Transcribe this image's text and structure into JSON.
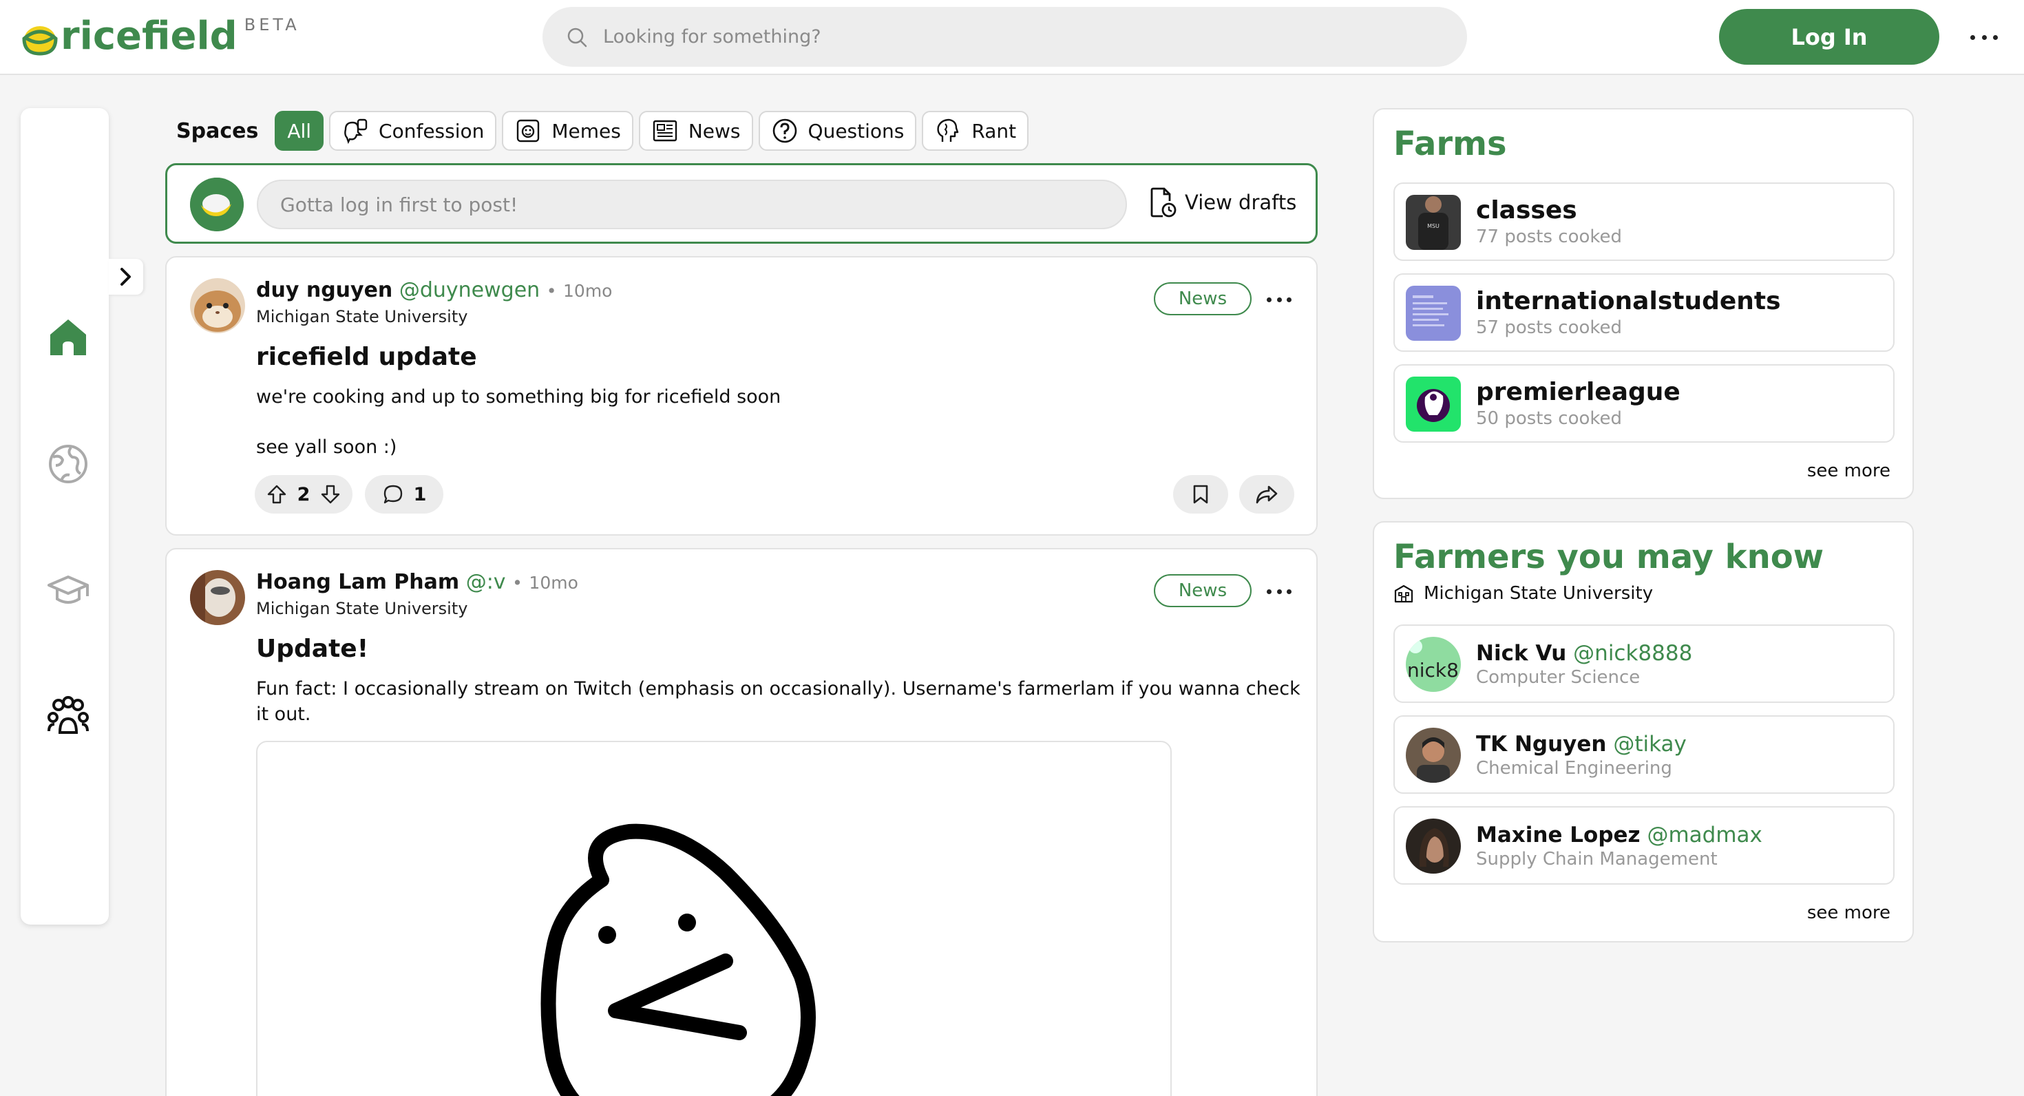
{
  "header": {
    "logo_text": "ricefield",
    "logo_badge": "BETA",
    "search_placeholder": "Looking for something?",
    "login_label": "Log In"
  },
  "spaces": {
    "label": "Spaces",
    "items": [
      {
        "label": "All",
        "icon": "none",
        "active": true
      },
      {
        "label": "Confession",
        "icon": "confession-icon"
      },
      {
        "label": "Memes",
        "icon": "memes-icon"
      },
      {
        "label": "News",
        "icon": "newspaper-icon"
      },
      {
        "label": "Questions",
        "icon": "question-icon"
      },
      {
        "label": "Rant",
        "icon": "rant-head-icon"
      }
    ]
  },
  "composer": {
    "placeholder": "Gotta log in first to post!",
    "drafts_label": "View drafts"
  },
  "posts": [
    {
      "author": "duy nguyen",
      "handle": "@duynewgen",
      "separator": "•",
      "time": "10mo",
      "school": "Michigan State University",
      "tag": "News",
      "title": "ricefield update",
      "body_line1": "we're cooking and up to something big for ricefield soon",
      "body_line2": "see yall soon :)",
      "votes": "2",
      "comments": "1"
    },
    {
      "author": "Hoang Lam Pham",
      "handle": "@:v",
      "separator": "•",
      "time": "10mo",
      "school": "Michigan State University",
      "tag": "News",
      "title": "Update!",
      "body_line1": "Fun fact: I occasionally stream on Twitch (emphasis on occasionally). Username's farmerlam if you wanna check",
      "body_line2": "it out."
    }
  ],
  "farms": {
    "title": "Farms",
    "items": [
      {
        "name": "classes",
        "posts": "77 posts cooked"
      },
      {
        "name": "internationalstudents",
        "posts": "57 posts cooked"
      },
      {
        "name": "premierleague",
        "posts": "50 posts cooked"
      }
    ],
    "see_more": "see more"
  },
  "farmers": {
    "title": "Farmers you may know",
    "school": "Michigan State University",
    "items": [
      {
        "name": "Nick Vu",
        "handle": "@nick8888",
        "major": "Computer Science",
        "avatar_text": "nick8"
      },
      {
        "name": "TK Nguyen",
        "handle": "@tikay",
        "major": "Chemical Engineering"
      },
      {
        "name": "Maxine Lopez",
        "handle": "@madmax",
        "major": "Supply Chain Management"
      }
    ],
    "see_more": "see more"
  },
  "colors": {
    "brand_green": "#3f8a4d",
    "background": "#f5f5f5",
    "pill_gray": "#ececec"
  }
}
